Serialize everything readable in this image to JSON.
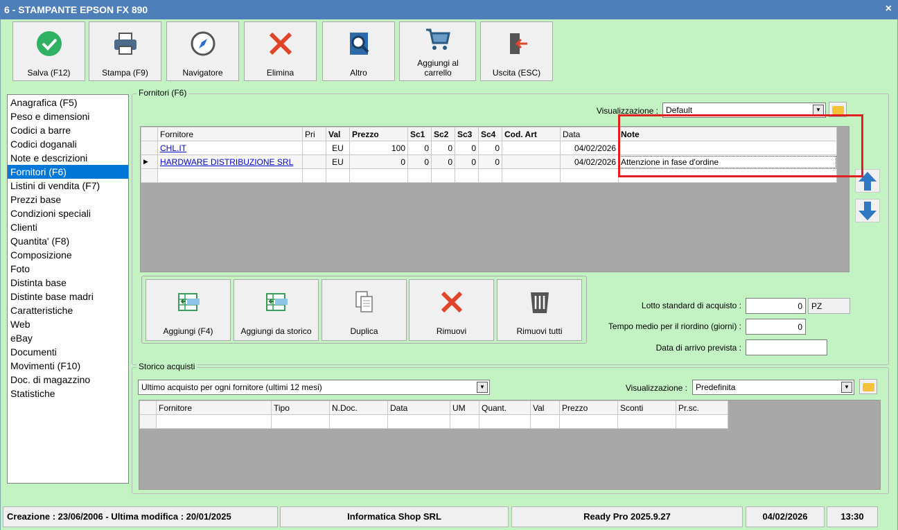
{
  "window": {
    "title": "6 - STAMPANTE EPSON FX 890",
    "close": "×"
  },
  "toolbar": [
    {
      "label": "Salva (F12)",
      "icon": "check-icon"
    },
    {
      "label": "Stampa (F9)",
      "icon": "printer-icon"
    },
    {
      "label": "Navigatore",
      "icon": "compass-icon"
    },
    {
      "label": "Elimina",
      "icon": "x-icon"
    },
    {
      "label": "Altro",
      "icon": "magnifier-book-icon"
    },
    {
      "label": "Aggiungi al carrello",
      "icon": "cart-icon"
    },
    {
      "label": "Uscita (ESC)",
      "icon": "exit-door-icon"
    }
  ],
  "nav": {
    "items": [
      "Anagrafica (F5)",
      "Peso e dimensioni",
      "Codici a barre",
      "Codici doganali",
      "Note e descrizioni",
      "Fornitori (F6)",
      "Listini di vendita (F7)",
      "Prezzi base",
      "Condizioni speciali",
      "Clienti",
      "Quantita' (F8)",
      "Composizione",
      "Foto",
      "Distinta base",
      "Distinte base madri",
      "Caratteristiche",
      "Web",
      "eBay",
      "Documenti",
      "Movimenti (F10)",
      "Doc. di magazzino",
      "Statistiche"
    ],
    "selected": 5
  },
  "fornitori": {
    "group_label": "Fornitori (F6)",
    "view_label": "Visualizzazione :",
    "view_value": "Default",
    "columns": [
      "Fornitore",
      "Pri",
      "Val",
      "Prezzo",
      "Sc1",
      "Sc2",
      "Sc3",
      "Sc4",
      "Cod. Art",
      "Data",
      "Note"
    ],
    "rows": [
      {
        "fornitore": "CHL.IT",
        "pri": "",
        "val": "EU",
        "prezzo": "100",
        "sc1": "0",
        "sc2": "0",
        "sc3": "0",
        "sc4": "0",
        "cod": "",
        "data": "04/02/2026",
        "note": ""
      },
      {
        "fornitore": "HARDWARE DISTRIBUZIONE SRL",
        "pri": "",
        "val": "EU",
        "prezzo": "0",
        "sc1": "0",
        "sc2": "0",
        "sc3": "0",
        "sc4": "0",
        "cod": "",
        "data": "04/02/2026",
        "note": "Attenzione in fase d'ordine"
      }
    ],
    "current_row_marker": "▶"
  },
  "actions": [
    {
      "label": "Aggiungi (F4)",
      "icon": "add-row-icon"
    },
    {
      "label": "Aggiungi da storico",
      "icon": "add-history-icon"
    },
    {
      "label": "Duplica",
      "icon": "duplicate-icon"
    },
    {
      "label": "Rimuovi",
      "icon": "x-icon"
    },
    {
      "label": "Rimuovi tutti",
      "icon": "trash-icon"
    }
  ],
  "fields": {
    "lotto_label": "Lotto standard di acquisto :",
    "lotto_value": "0",
    "lotto_unit": "PZ",
    "tempo_label": "Tempo medio per il riordino (giorni) :",
    "tempo_value": "0",
    "arrivo_label": "Data di arrivo prevista :",
    "arrivo_value": ""
  },
  "storico": {
    "group_label": "Storico acquisti",
    "filter_value": "Ultimo acquisto per ogni fornitore (ultimi 12 mesi)",
    "view_label": "Visualizzazione :",
    "view_value": "Predefinita",
    "columns": [
      "Fornitore",
      "Tipo",
      "N.Doc.",
      "Data",
      "UM",
      "Quant.",
      "Val",
      "Prezzo",
      "Sconti",
      "Pr.sc."
    ]
  },
  "status": {
    "dates": "Creazione : 23/06/2006 - Ultima modifica : 20/01/2025",
    "company": "Informatica Shop SRL",
    "version": "Ready Pro 2025.9.27",
    "date": "04/02/2026",
    "time": "13:30"
  },
  "colors": {
    "accent": "#0078d7",
    "background": "#c3f3c3",
    "titlebar": "#4f7fb8",
    "highlight": "#e02020"
  }
}
